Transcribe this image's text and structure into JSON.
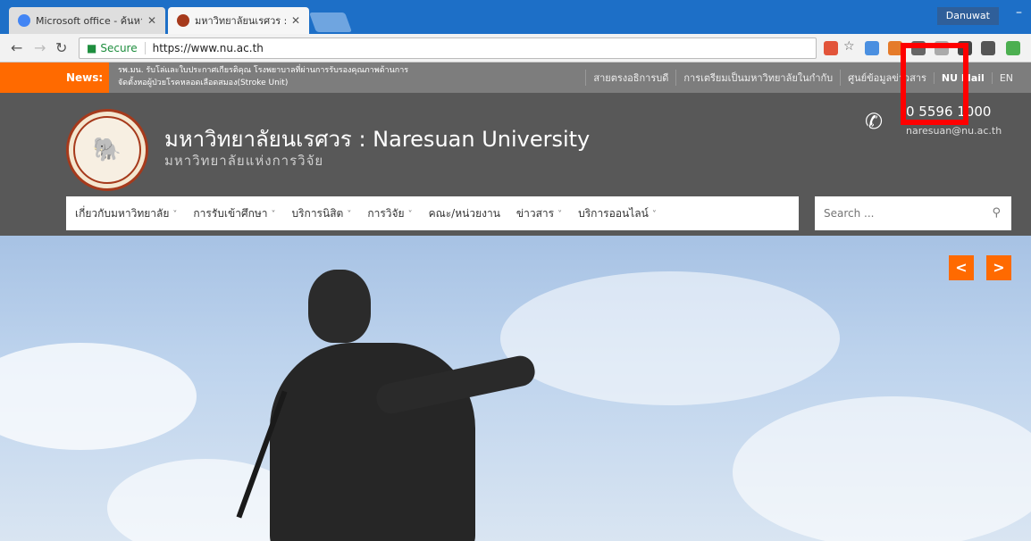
{
  "browser": {
    "tabs": [
      {
        "title": "Microsoft office - ค้นหาด้",
        "favicon_color": "#4285f4"
      },
      {
        "title": "มหาวิทยาลัยนเรศวร : Nares",
        "favicon_color": "#a63a1c"
      }
    ],
    "user": "Danuwat",
    "address": {
      "secure_label": "Secure",
      "url": "https://www.nu.ac.th"
    }
  },
  "newsbar": {
    "label": "News:",
    "text": "รพ.มน. รับโล่และใบประกาศเกียรติคุณ โรงพยาบาลที่ผ่านการรับรองคุณภาพด้านการจัดตั้งหอผู้ป่วยโรคหลอดเลือดสมอง(Stroke Unit)",
    "links": [
      "สายตรงอธิการบดี",
      "การเตรียมเป็นมหาวิทยาลัยในกำกับ",
      "ศูนย์ข้อมูลข่าวสาร",
      "NU Mail",
      "EN"
    ]
  },
  "header": {
    "title": "มหาวิทยาลัยนเรศวร : Naresuan University",
    "subtitle": "มหาวิทยาลัยแห่งการวิจัย",
    "phone": "0 5596 1000",
    "email": "naresuan@nu.ac.th"
  },
  "mainnav": {
    "items": [
      {
        "label": "เกี่ยวกับมหาวิทยาลัย",
        "dropdown": "˅"
      },
      {
        "label": "การรับเข้าศึกษา",
        "dropdown": "˅"
      },
      {
        "label": "บริการนิสิต",
        "dropdown": "˅"
      },
      {
        "label": "การวิจัย",
        "dropdown": "˅"
      },
      {
        "label": "คณะ/หน่วยงาน",
        "dropdown": ""
      },
      {
        "label": "ข่าวสาร",
        "dropdown": "˅"
      },
      {
        "label": "บริการออนไลน์",
        "dropdown": "˅"
      }
    ],
    "search_placeholder": "Search ..."
  },
  "hero": {
    "prev_label": "<",
    "next_label": ">"
  },
  "colors": {
    "accent": "#ff6a00",
    "header_bg": "#585858",
    "highlight": "#ff0000"
  }
}
